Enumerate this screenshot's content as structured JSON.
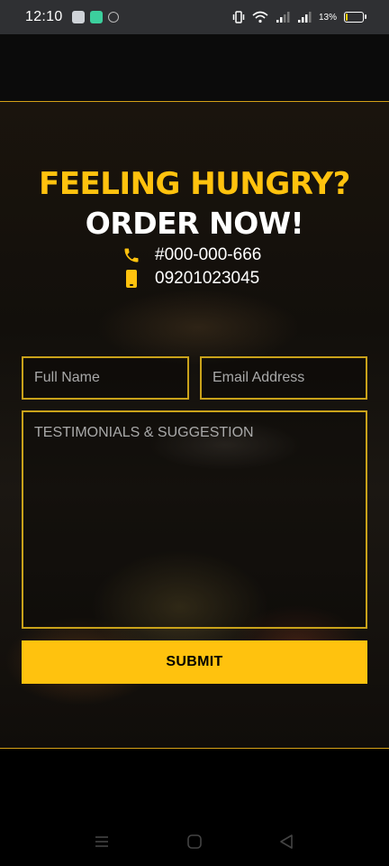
{
  "status_bar": {
    "time": "12:10",
    "battery_percent": "13%",
    "battery_level": 0.13,
    "accent": "#ffcc00"
  },
  "hero": {
    "headline": "FEELING HUNGRY?",
    "subheadline": "ORDER NOW!",
    "phone_icon": "phone-icon",
    "phone": "#000-000-666",
    "mobile_icon": "mobile-icon",
    "mobile": "09201023045",
    "accent_color": "#ffc20e"
  },
  "form": {
    "full_name_placeholder": "Full Name",
    "email_placeholder": "Email Address",
    "message_placeholder": "TESTIMONIALS & SUGGESTION",
    "submit_label": "SUBMIT"
  },
  "nav": {
    "menu_icon": "recent-apps-icon",
    "home_icon": "home-icon",
    "back_icon": "back-icon"
  }
}
